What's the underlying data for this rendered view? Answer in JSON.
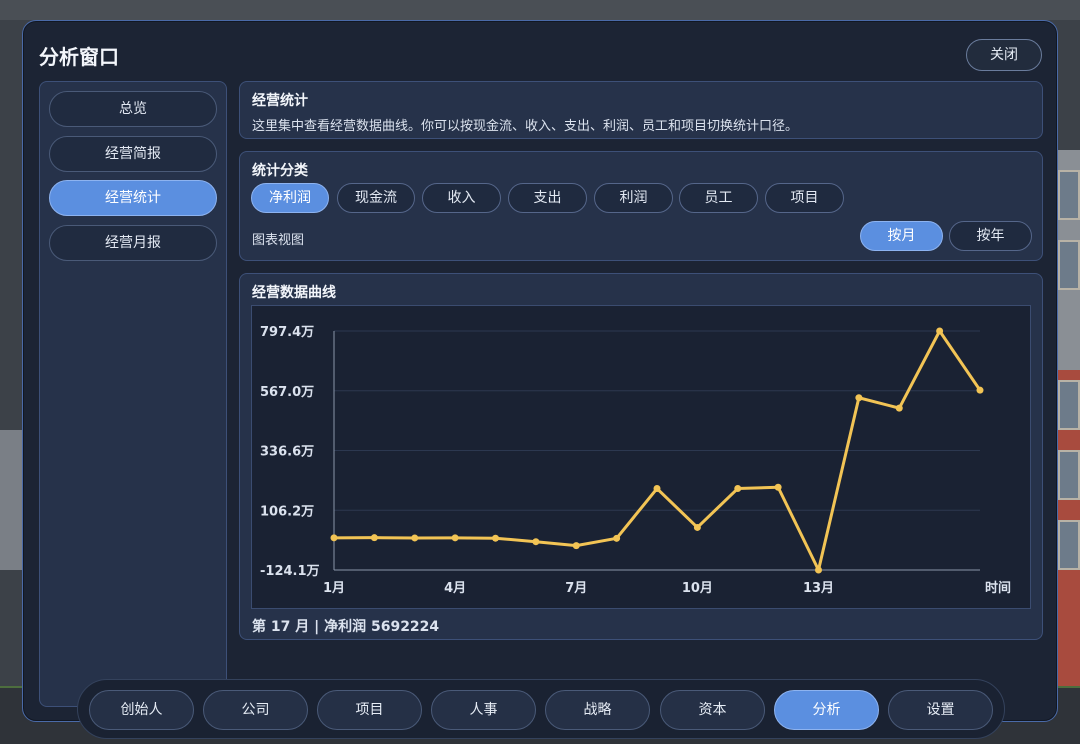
{
  "window": {
    "title": "分析窗口",
    "close_label": "关闭"
  },
  "sidebar": {
    "items": [
      {
        "label": "总览",
        "active": false
      },
      {
        "label": "经营简报",
        "active": false
      },
      {
        "label": "经营统计",
        "active": true
      },
      {
        "label": "经营月报",
        "active": false
      }
    ]
  },
  "intro": {
    "title": "经营统计",
    "description": "这里集中查看经营数据曲线。你可以按现金流、收入、支出、利润、员工和项目切换统计口径。"
  },
  "categories": {
    "title": "统计分类",
    "items": [
      "净利润",
      "现金流",
      "收入",
      "支出",
      "利润",
      "员工",
      "项目"
    ],
    "selected": "净利润",
    "view_label": "图表视图",
    "periods": [
      "按月",
      "按年"
    ],
    "selected_period": "按月"
  },
  "chart_panel": {
    "title": "经营数据曲线",
    "footer": "第 17 月 | 净利润 5692224"
  },
  "chart_data": {
    "type": "line",
    "xlabel": "时间",
    "ylabel": "",
    "x_ticks": [
      "1月",
      "4月",
      "7月",
      "10月",
      "13月"
    ],
    "y_ticks": [
      "797.4万",
      "567.0万",
      "336.6万",
      "106.2万",
      "-124.1万"
    ],
    "ylim": [
      -1241000,
      7974000
    ],
    "x": [
      1,
      2,
      3,
      4,
      5,
      6,
      7,
      8,
      9,
      10,
      11,
      12,
      13,
      14,
      15,
      16,
      17
    ],
    "series": [
      {
        "values": [
          0,
          5000,
          -5000,
          0,
          -15000,
          -150000,
          -300000,
          -20000,
          1900000,
          400000,
          1900000,
          1950000,
          -1241000,
          5400000,
          5000000,
          7974000,
          5692224
        ],
        "color": "#f2c455"
      }
    ],
    "grid": true
  },
  "bottom_nav": {
    "items": [
      {
        "label": "创始人",
        "active": false
      },
      {
        "label": "公司",
        "active": false
      },
      {
        "label": "项目",
        "active": false
      },
      {
        "label": "人事",
        "active": false
      },
      {
        "label": "战略",
        "active": false
      },
      {
        "label": "资本",
        "active": false
      },
      {
        "label": "分析",
        "active": true
      },
      {
        "label": "设置",
        "active": false
      }
    ]
  }
}
